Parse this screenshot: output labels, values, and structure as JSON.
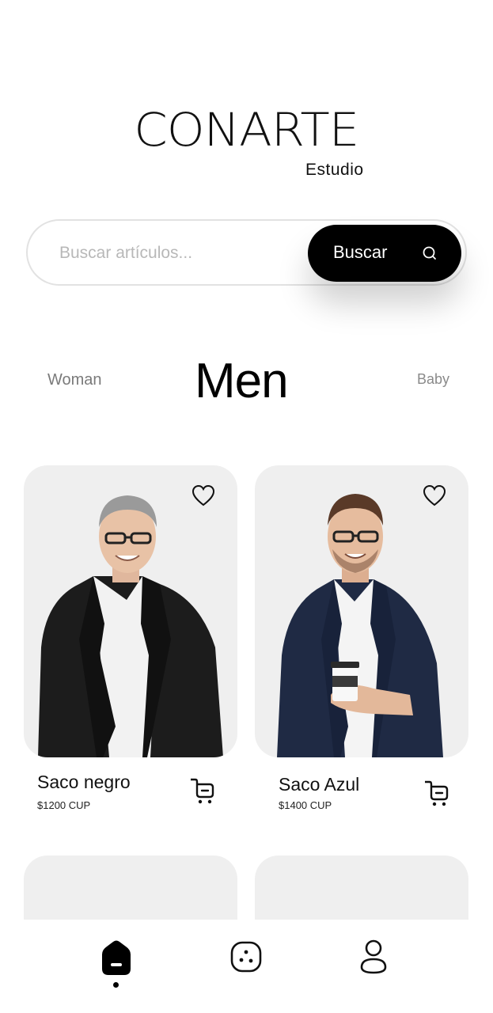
{
  "brand": {
    "name": "CONARTE",
    "subtitle": "Estudio"
  },
  "search": {
    "placeholder": "Buscar artículos...",
    "value": "",
    "button_label": "Buscar",
    "button_icon": "search-icon"
  },
  "categories": {
    "items": [
      {
        "label": "Woman",
        "active": false
      },
      {
        "label": "Men",
        "active": true
      },
      {
        "label": "Baby",
        "active": false
      }
    ]
  },
  "products": [
    {
      "name": "Saco negro",
      "price": "$1200 CUP",
      "favorite": false,
      "image": "man-black-blazer",
      "jacket_color": "#1a1a1a"
    },
    {
      "name": "Saco Azul",
      "price": "$1400 CUP",
      "favorite": false,
      "image": "man-navy-blazer-coffee",
      "jacket_color": "#1f2a44"
    }
  ],
  "bottom_nav": {
    "items": [
      {
        "icon": "home-icon",
        "active": true
      },
      {
        "icon": "categories-icon",
        "active": false
      },
      {
        "icon": "profile-icon",
        "active": false
      }
    ]
  },
  "colors": {
    "accent": "#000000",
    "card_background": "#efefef",
    "placeholder": "#b8b8b8"
  }
}
